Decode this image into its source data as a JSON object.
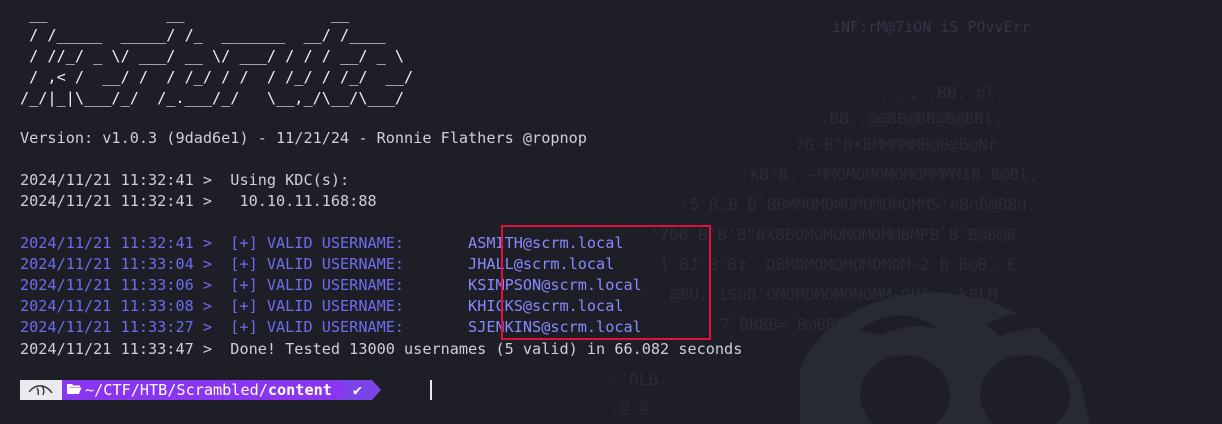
{
  "banner": " __             __                __\n / /_____  _____/ /_  _______  __/ /____\n / //_/ _ \\/ ___/ __ \\/ ___/ / / / __/ _ \\\n / ,< /  __/ /  / /_/ / /  / /_/ / /_/  __/\n/_/|_|\\___/_/  /_.___/_/   \\__,_/\\__/\\___/",
  "version_line": "Version: v1.0.3 (9dad6e1) - 11/21/24 - Ronnie Flathers @ropnop",
  "kdc": {
    "line1": "2024/11/21 11:32:41 >  Using KDC(s):",
    "line2": "2024/11/21 11:32:41 >   10.10.11.168:88"
  },
  "valid_users": [
    {
      "prefix": "2024/11/21 11:32:41 >  [+] VALID USERNAME:       ",
      "user": "ASMITH@scrm.local"
    },
    {
      "prefix": "2024/11/21 11:33:04 >  [+] VALID USERNAME:       ",
      "user": "JHALL@scrm.local"
    },
    {
      "prefix": "2024/11/21 11:33:06 >  [+] VALID USERNAME:       ",
      "user": "KSIMPSON@scrm.local"
    },
    {
      "prefix": "2024/11/21 11:33:08 >  [+] VALID USERNAME:       ",
      "user": "KHICKS@scrm.local"
    },
    {
      "prefix": "2024/11/21 11:33:27 >  [+] VALID USERNAME:       ",
      "user": "SJENKINS@scrm.local"
    }
  ],
  "done_line": "2024/11/21 11:33:47 >  Done! Tested 13000 usernames (5 valid) in 66.082 seconds",
  "prompt": {
    "os_icon": "kali-dragon-icon",
    "folder_icon": "folder-open-icon",
    "path_prefix": "~/CTF/HTB/Scrambled/",
    "path_current": "content",
    "status_icon": "check-icon",
    "status_symbol": "✔"
  },
  "background_art": {
    "watermark_line": "iNF:rM@7iON iS POvvErr"
  },
  "colors": {
    "background": "#1d1e26",
    "text": "#cfd0d6",
    "valid_text": "#6f6cf0",
    "highlight_box": "#e0103f",
    "prompt_path_bg": "#8a35f0",
    "prompt_status_bg": "#7a44e8"
  }
}
